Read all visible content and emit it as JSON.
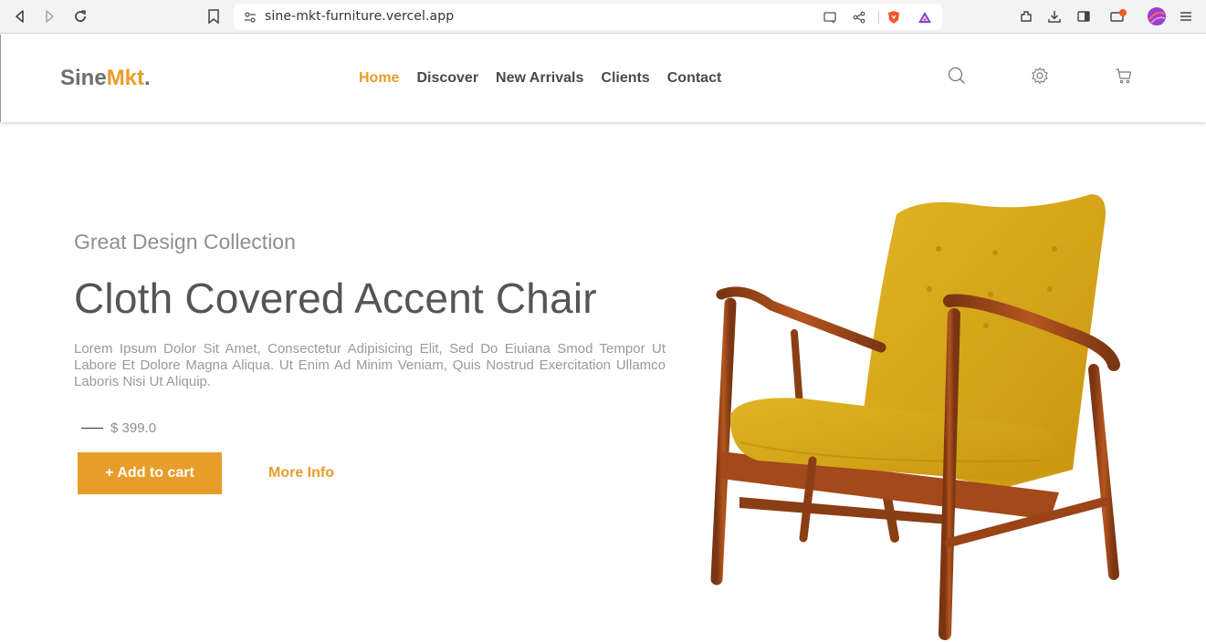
{
  "browser": {
    "url": "sine-mkt-furniture.vercel.app"
  },
  "site": {
    "logo_main": "Sine",
    "logo_accent": "Mkt",
    "logo_dot": ".",
    "accent_color": "#e89d2a",
    "nav": [
      {
        "label": "Home",
        "active": true
      },
      {
        "label": "Discover",
        "active": false
      },
      {
        "label": "New Arrivals",
        "active": false
      },
      {
        "label": "Clients",
        "active": false
      },
      {
        "label": "Contact",
        "active": false
      }
    ],
    "header_icons": [
      "search-icon",
      "gear-icon",
      "cart-icon"
    ]
  },
  "hero": {
    "subtitle": "Great Design Collection",
    "title": "Cloth Covered Accent Chair",
    "description": "Lorem Ipsum Dolor Sit Amet, Consectetur Adipisicing Elit, Sed Do Eiuiana Smod Tempor Ut Labore Et Dolore Magna Aliqua. Ut Enim Ad Minim Veniam, Quis Nostrud Exercitation Ullamco Laboris Nisi Ut Aliquip.",
    "price": "$ 399.0",
    "add_to_cart": "+ Add to cart",
    "more_info": "More Info"
  }
}
